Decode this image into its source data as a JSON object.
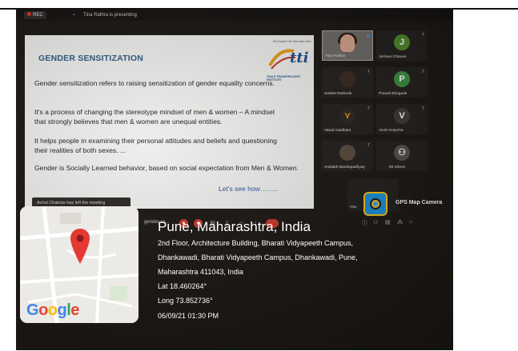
{
  "zoom": {
    "rec_label": "REC",
    "presenting_text": "Tina Rathra is presenting",
    "screen_share_name": "gender se...",
    "leave_notice": "Achal Chakote has left the meeting"
  },
  "slide": {
    "title": "GENDER SENSITIZATION",
    "paragraphs": [
      "Gender sensitization refers to  raising sensitization of gender equality concerns.",
      "It's a process of changing the stereotype mindset of men & women – A mindset that strongly believes that men & women are unequal entities.",
      "It helps people in examining their personal attitudes and beliefs and questioning their realities of both sexes. ...",
      "Gender is Socially Learned behavior, based on social expectation from Men & Women."
    ],
    "footer": "Let's see how……..",
    "logo": {
      "tagline": "We Prepare The Generation Next",
      "letters": "tti",
      "name": "TINA'S TRANSFROLIGHT INSTITUTE"
    }
  },
  "participants": [
    {
      "name": "Tina Rathra",
      "initial": "",
      "color": ""
    },
    {
      "name": "Janhavi Chavan",
      "initial": "J",
      "color": "#4d8a2b"
    },
    {
      "name": "Sanket Rathode",
      "initial": "",
      "color": ""
    },
    {
      "name": "Pranali Bhegade",
      "initial": "P",
      "color": "#3c8e3f"
    },
    {
      "name": "Varad Gaidhani",
      "initial": "",
      "color": ""
    },
    {
      "name": "Vivek Kotecha",
      "initial": "V",
      "color": "#3e3a38"
    },
    {
      "name": "Amitabh Bandopadhyay",
      "initial": "",
      "color": ""
    },
    {
      "name": "59 others",
      "initial": "",
      "color": ""
    },
    {
      "name": "You",
      "initial": "",
      "color": ""
    }
  ],
  "gps_app": {
    "label": "GPS Map Camera"
  },
  "stamp": {
    "title": "Pune, Maharashtra, India",
    "address_lines": [
      "2nd Floor, Architecture Building, Bharati Vidyapeeth Campus,",
      "Dhankawadi, Bharati Vidyapeeth Campus, Dhankawadi, Pune,",
      "Maharashtra 411043, India"
    ],
    "lat": "Lat 18.460264°",
    "long": "Long 73.852736°",
    "datetime": "06/09/21 01:30 PM",
    "map_brand": "Google"
  },
  "colors": {
    "slide_title": "#2d5a83",
    "pin": "#e53935",
    "rec_dot": "#e0322d",
    "end_button": "#c9362e"
  },
  "icons": [
    "record-icon",
    "chevron-icon",
    "mic-icon",
    "video-icon",
    "share-icon",
    "chat-icon",
    "reactions-icon",
    "more-icon",
    "end-call-icon",
    "map-pin-icon",
    "gps-camera-icon"
  ]
}
